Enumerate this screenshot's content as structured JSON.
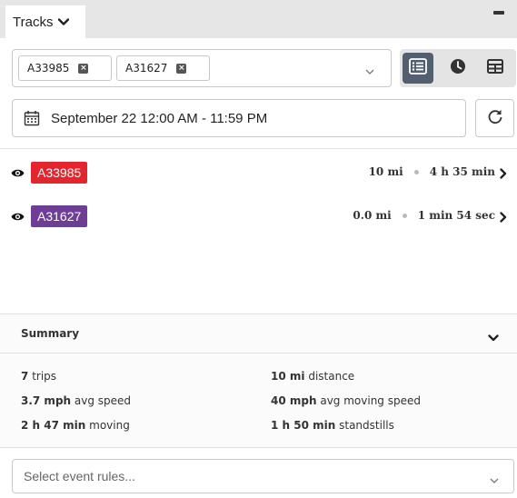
{
  "header": {
    "tab_label": "Tracks"
  },
  "selector": {
    "chips": [
      {
        "label": "A33985"
      },
      {
        "label": "A31627"
      }
    ]
  },
  "date_range": {
    "value": "September 22 12:00 AM - 11:59 PM"
  },
  "tracks": [
    {
      "id": "A33985",
      "distance": "10 mi",
      "duration": "4 h 35 min",
      "color": "#e3262d"
    },
    {
      "id": "A31627",
      "distance": "0.0 mi",
      "duration": "1 min 54 sec",
      "color": "#6e3d96"
    }
  ],
  "summary": {
    "title": "Summary",
    "trips": {
      "value": "7",
      "label": "trips"
    },
    "distance": {
      "value": "10 mi",
      "label": "distance"
    },
    "avg_speed": {
      "value": "3.7 mph",
      "label": "avg speed"
    },
    "avg_moving_speed": {
      "value": "40 mph",
      "label": "avg moving speed"
    },
    "moving": {
      "value": "2 h 47 min",
      "label": "moving"
    },
    "standstills": {
      "value": "1 h 50 min",
      "label": "standstills"
    }
  },
  "event_rules": {
    "placeholder": "Select event rules..."
  },
  "icons": {
    "tab_chevron": "chevron-down-icon",
    "minimize": "minimize-icon",
    "chip_remove": "close-icon",
    "selector_caret": "caret-down-icon",
    "list_view": "list-icon",
    "timeline_view": "clock-icon",
    "table_view": "table-icon",
    "calendar": "calendar-icon",
    "refresh": "refresh-icon",
    "visibility": "eye-icon",
    "row_chevron": "chevron-right-icon"
  }
}
